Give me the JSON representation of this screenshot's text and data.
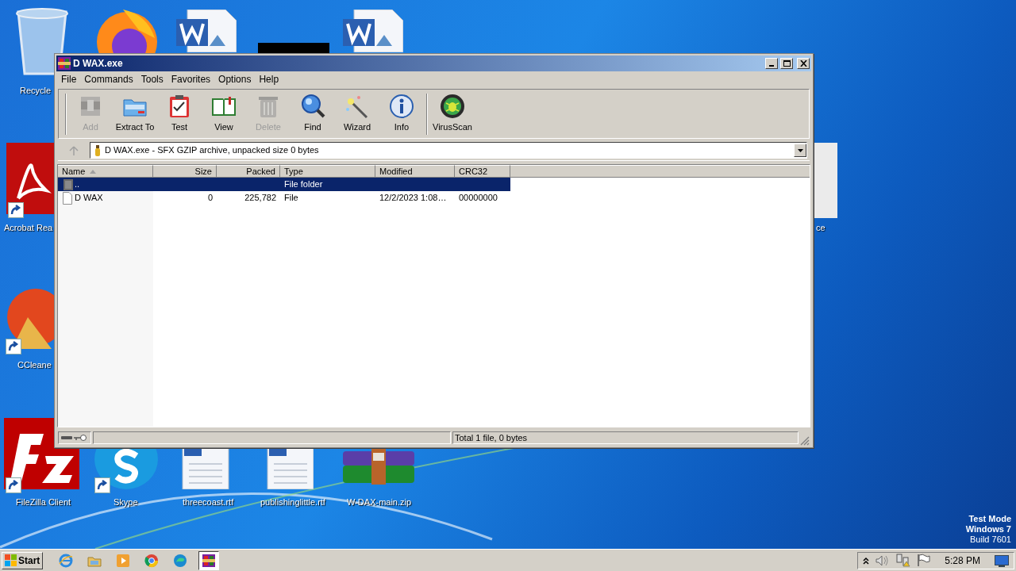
{
  "desktop_icons": [
    {
      "label": "Recycle",
      "kind": "bin",
      "shortcut": false
    },
    {
      "label": "Acrobat Rea",
      "kind": "acrobat",
      "shortcut": true
    },
    {
      "label": "CCleane",
      "kind": "cleaner",
      "shortcut": true
    },
    {
      "label": "FileZilla Client",
      "kind": "filezilla",
      "shortcut": true
    },
    {
      "label": "Skype",
      "kind": "skype",
      "shortcut": true
    },
    {
      "label": "threecoast.rtf",
      "kind": "doc",
      "shortcut": false
    },
    {
      "label": "publishinglittle.rtf",
      "kind": "doc",
      "shortcut": false
    },
    {
      "label": "W-DAX-main.zip",
      "kind": "archive",
      "shortcut": false
    },
    {
      "label": "ce",
      "kind": "blank",
      "shortcut": false
    }
  ],
  "desktop_notice": [
    "Test Mode",
    "Windows 7",
    "Build 7601"
  ],
  "window": {
    "title": "D WAX.exe",
    "menu": [
      "File",
      "Commands",
      "Tools",
      "Favorites",
      "Options",
      "Help"
    ],
    "toolbar": [
      {
        "label": "Add",
        "disabled": true
      },
      {
        "label": "Extract To",
        "disabled": false
      },
      {
        "label": "Test",
        "disabled": false
      },
      {
        "label": "View",
        "disabled": false
      },
      {
        "label": "Delete",
        "disabled": true
      },
      {
        "label": "Find",
        "disabled": false
      },
      {
        "label": "Wizard",
        "disabled": false
      },
      {
        "label": "Info",
        "disabled": false
      },
      {
        "label": "VirusScan",
        "disabled": false
      }
    ],
    "address": "D WAX.exe - SFX GZIP archive, unpacked size 0 bytes",
    "columns": [
      {
        "label": "Name",
        "sorted": true
      },
      {
        "label": "Size",
        "sorted": false
      },
      {
        "label": "Packed",
        "sorted": false
      },
      {
        "label": "Type",
        "sorted": false
      },
      {
        "label": "Modified",
        "sorted": false
      },
      {
        "label": "CRC32",
        "sorted": false
      }
    ],
    "rows": [
      {
        "kind": "folder",
        "selected": true,
        "name": "..",
        "size": "",
        "packed": "",
        "type": "File folder",
        "modified": "",
        "crc32": ""
      },
      {
        "kind": "file",
        "selected": false,
        "name": "D WAX",
        "size": "0",
        "packed": "225,782",
        "type": "File",
        "modified": "12/2/2023 1:08…",
        "crc32": "00000000"
      }
    ],
    "status": "Total 1 file, 0 bytes"
  },
  "taskbar": {
    "start": "Start",
    "apps": [
      {
        "selected": false
      },
      {
        "selected": false
      },
      {
        "selected": false
      },
      {
        "selected": false
      },
      {
        "selected": false
      },
      {
        "selected": true
      }
    ],
    "clock": "5:28 PM"
  }
}
